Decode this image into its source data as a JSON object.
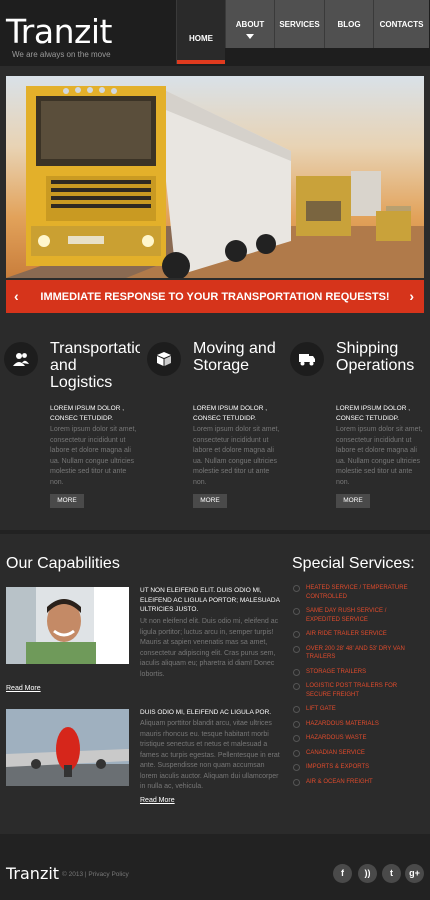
{
  "header": {
    "logo": "Tranzit",
    "tagline": "We are always on the move",
    "nav": [
      {
        "label": "HOME"
      },
      {
        "label": "ABOUT"
      },
      {
        "label": "SERVICES"
      },
      {
        "label": "BLOG"
      },
      {
        "label": "CONTACTS"
      }
    ]
  },
  "hero": {
    "banner_text": "IMMEDIATE RESPONSE TO YOUR TRANSPORTATION REQUESTS!",
    "prev_icon": "chevron-left-icon",
    "next_icon": "chevron-right-icon"
  },
  "services": [
    {
      "icon": "people-icon",
      "title": "Transportation\nand\nLogistics",
      "subtitle": "LOREM IPSUM DOLOR , CONSEC TETUDIDP.",
      "text": "Lorem ipsum dolor sit amet, consectetur incididunt ut labore et dolore magna ali ua. Nullam congue ultricies molestie sed titor ut ante non.",
      "button": "MORE"
    },
    {
      "icon": "box-icon",
      "title": "Moving and\nStorage",
      "subtitle": "LOREM IPSUM DOLOR , CONSEC TETUDIDP.",
      "text": "Lorem ipsum dolor sit amet, consectetur incididunt ut labore et dolore magna ali ua. Nullam congue ultricies molestie sed titor ut ante non.",
      "button": "MORE"
    },
    {
      "icon": "truck-icon",
      "title": "Shipping\nOperations",
      "subtitle": "LOREM IPSUM DOLOR , CONSEC TETUDIDP.",
      "text": "Lorem ipsum dolor sit amet, consectetur incididunt ut labore et dolore magna ali ua. Nullam congue ultricies molestie sed titor ut ante non.",
      "button": "MORE"
    }
  ],
  "capabilities": {
    "heading": "Our Capabilities",
    "items": [
      {
        "title": "UT NON ELEIFEND ELIT. DUIS ODIO MI, ELEIFEND AC LIGULA PORTOR; MALESUADA ULTRICIES JUSTO.",
        "text": "Ut non eleifend elit. Duis odio mi, eleifend ac ligula portitor; luctus arcu in, semper turpis! Mauris at sapien venenatis mas sa amet, consectetur adipiscing elit. Cras purus sem, iaculis aliquam eu; pharetra id diam! Donec lobortis.",
        "link": "Read More"
      },
      {
        "title": "DUIS ODIO MI, ELEIFEND AC LIGULA POR.",
        "text": "Aliquam porttitor blandit arcu, vitae ultrices mauris rhoncus eu. tesque habitant morbi tristique senectus et netus et malesuad a fames ac turpis egestas. Pellentesque in erat ante. Suspendisse non quam accumsan lorem iaculis auctor. Aliquam dui ullamcorper in nulla ac, vehicula.",
        "link": "Read More"
      }
    ]
  },
  "special_services": {
    "heading": "Special Services:",
    "items": [
      "HEATED SERVICE / TEMPERATURE CONTROLLED",
      "SAME DAY RUSH SERVICE / EXPEDITED SERVICE",
      "AIR RIDE TRAILER SERVICE",
      "OVER 200 28' 48' AND 53' DRY VAN TRAILERS",
      "STORAGE TRAILERS",
      "LOGISTIC POST TRAILERS FOR SECURE FREIGHT",
      "LIFT GATE",
      "HAZARDOUS MATERIALS",
      "HAZARDOUS WASTE",
      "CANADIAN SERVICE",
      "IMPORTS & EXPORTS",
      "AIR & OCEAN FREIGHT"
    ]
  },
  "footer": {
    "logo": "Tranzit",
    "copyright": "© 2013 | Privacy Policy",
    "social": [
      {
        "icon": "facebook-icon",
        "glyph": "f"
      },
      {
        "icon": "rss-icon",
        "glyph": "))"
      },
      {
        "icon": "twitter-icon",
        "glyph": "t"
      },
      {
        "icon": "google-plus-icon",
        "glyph": "g+"
      }
    ]
  }
}
